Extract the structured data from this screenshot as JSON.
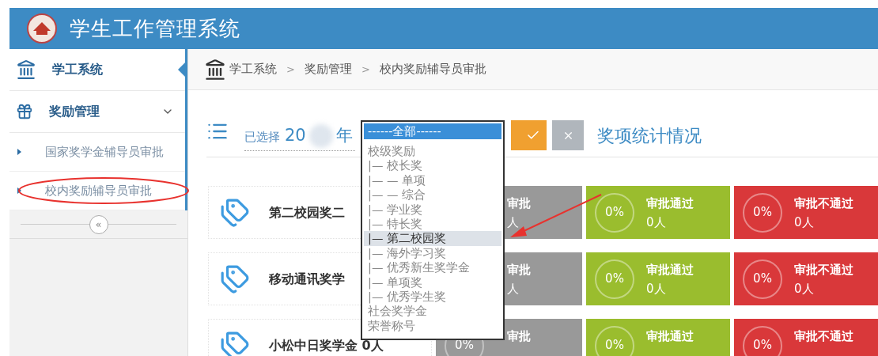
{
  "header": {
    "title": "学生工作管理系统"
  },
  "sidebar": {
    "items": [
      {
        "label": "学工系统",
        "kind": "top",
        "selected": true
      },
      {
        "label": "奖励管理",
        "kind": "group",
        "selected": false,
        "expanded": true,
        "children": [
          {
            "label": "国家奖学金辅导员审批"
          },
          {
            "label": "校内奖励辅导员审批"
          }
        ]
      }
    ],
    "collapse": "«"
  },
  "breadcrumb": {
    "items": [
      "学工系统",
      "奖励管理",
      "校内奖励辅导员审批"
    ],
    "separator": ">"
  },
  "toolbar": {
    "selected_label": "已选择",
    "year_prefix": "20",
    "year_suffix": "年",
    "stats_title": "奖项统计情况"
  },
  "dropdown": {
    "options": [
      {
        "label": "------全部------",
        "selected": true,
        "hovered": false
      },
      {
        "label": "校级奖励",
        "selected": false,
        "hovered": false
      },
      {
        "label": "|— 校长奖",
        "selected": false,
        "hovered": false
      },
      {
        "label": "|— — 单项",
        "selected": false,
        "hovered": false
      },
      {
        "label": "|— — 综合",
        "selected": false,
        "hovered": false
      },
      {
        "label": "|— 学业奖",
        "selected": false,
        "hovered": false
      },
      {
        "label": "|— 特长奖",
        "selected": false,
        "hovered": false
      },
      {
        "label": "|— 第二校园奖",
        "selected": false,
        "hovered": true
      },
      {
        "label": "|— 海外学习奖",
        "selected": false,
        "hovered": false
      },
      {
        "label": "|— 优秀新生奖学金",
        "selected": false,
        "hovered": false
      },
      {
        "label": "|— 单项奖",
        "selected": false,
        "hovered": false
      },
      {
        "label": "|— 优秀学生奖",
        "selected": false,
        "hovered": false
      },
      {
        "label": "社会奖学金",
        "selected": false,
        "hovered": false
      },
      {
        "label": "荣誉称号",
        "selected": false,
        "hovered": false
      }
    ]
  },
  "cards": [
    {
      "name": "第二校园奖二",
      "pending": {
        "title": "审批",
        "count": "人"
      },
      "approved": {
        "percent": "0%",
        "title": "审批通过",
        "count": "0人"
      },
      "rejected": {
        "percent": "0%",
        "title": "审批不通过",
        "count": "0人"
      }
    },
    {
      "name": "移动通讯奖学",
      "pending": {
        "title": "审批",
        "count": "人"
      },
      "approved": {
        "percent": "0%",
        "title": "审批通过",
        "count": "0人"
      },
      "rejected": {
        "percent": "0%",
        "title": "审批不通过",
        "count": "0人"
      }
    },
    {
      "name": "小松中日奖学金 0人",
      "pending": {
        "percent": "0%",
        "title": "审批"
      },
      "approved": {
        "percent": "0%",
        "title": "审批通过"
      },
      "rejected": {
        "percent": "0%",
        "title": "审批不通过"
      }
    }
  ]
}
